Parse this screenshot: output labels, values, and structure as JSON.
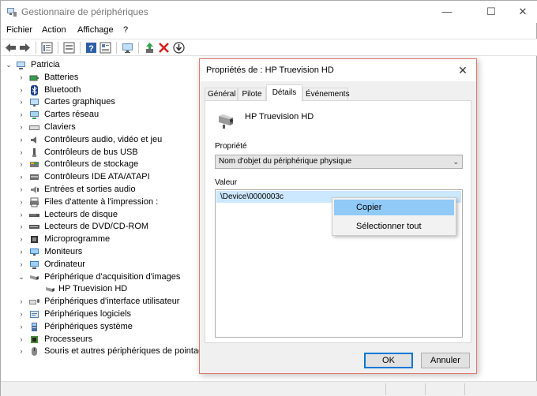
{
  "window": {
    "title": "Gestionnaire de périphériques",
    "minimize": "—",
    "maximize": "☐",
    "close": "✕"
  },
  "menu": [
    "Fichier",
    "Action",
    "Affichage",
    "?"
  ],
  "tree": {
    "root": "Patricia",
    "categories": [
      "Batteries",
      "Bluetooth",
      "Cartes graphiques",
      "Cartes réseau",
      "Claviers",
      "Contrôleurs audio, vidéo et jeu",
      "Contrôleurs de bus USB",
      "Contrôleurs de stockage",
      "Contrôleurs IDE ATA/ATAPI",
      "Entrées et sorties audio",
      "Files d'attente à l'impression :",
      "Lecteurs de disque",
      "Lecteurs de DVD/CD-ROM",
      "Microprogramme",
      "Moniteurs",
      "Ordinateur",
      "Périphérique d'acquisition d'images",
      "HP Truevision HD",
      "Périphériques d'interface utilisateur",
      "Périphériques logiciels",
      "Périphériques système",
      "Processeurs",
      "Souris et autres périphériques de pointage"
    ]
  },
  "dialog": {
    "title": "Propriétés de : HP Truevision HD",
    "close": "✕",
    "tabs": [
      "Général",
      "Pilote",
      "Détails",
      "Événements"
    ],
    "device_name": "HP Truevision HD",
    "property_label": "Propriété",
    "property_value": "Nom d'objet du périphérique physique",
    "value_label": "Valeur",
    "value_row": "\\Device\\0000003c",
    "ok": "OK",
    "cancel": "Annuler"
  },
  "context_menu": {
    "copy": "Copier",
    "select_all": "Sélectionner tout"
  },
  "colors": {
    "dialog_border": "#e0776b",
    "selection": "#cce8ff",
    "menu_highlight": "#91c9f7",
    "default_button": "#0078d7"
  }
}
